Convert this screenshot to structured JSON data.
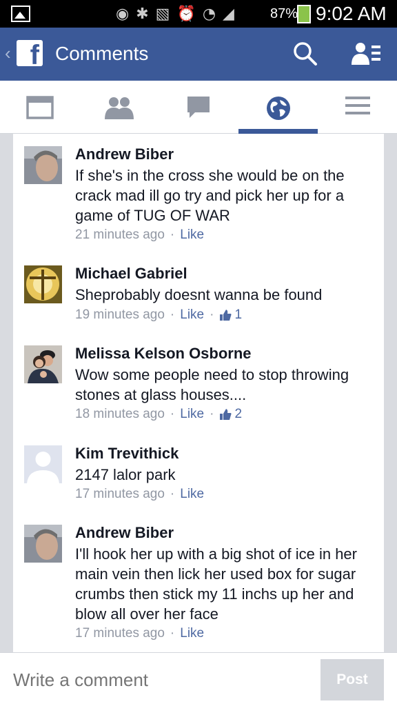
{
  "status_bar": {
    "battery": "87%",
    "time": "9:02 AM"
  },
  "header": {
    "back_glyph": "‹",
    "logo_letter": "f",
    "title": "Comments"
  },
  "tabs": [
    {
      "icon": "news-feed-icon",
      "active": false
    },
    {
      "icon": "friends-icon",
      "active": false
    },
    {
      "icon": "messages-icon",
      "active": false
    },
    {
      "icon": "globe-icon",
      "active": true
    },
    {
      "icon": "menu-icon",
      "active": false
    }
  ],
  "comments": [
    {
      "author": "Andrew Biber",
      "text": "If she's in the cross she would be on the crack mad ill go try and pick her up for a game of TUG OF WAR",
      "time": "21 minutes ago",
      "like_label": "Like",
      "likes": ""
    },
    {
      "author": "Michael Gabriel",
      "text": "Sheprobably doesnt wanna be found",
      "time": "19 minutes ago",
      "like_label": "Like",
      "likes": "1"
    },
    {
      "author": "Melissa Kelson Osborne",
      "text": "Wow some people need to stop throwing stones at glass houses....",
      "time": "18 minutes ago",
      "like_label": "Like",
      "likes": "2"
    },
    {
      "author": "Kim Trevithick",
      "text": "2147 lalor park",
      "time": "17 minutes ago",
      "like_label": "Like",
      "likes": ""
    },
    {
      "author": "Andrew Biber",
      "text": "I'll hook her up with a big shot of ice in her main vein then lick her used box for sugar crumbs then stick my 11 inchs up her and blow all over her face",
      "time": "17 minutes ago",
      "like_label": "Like",
      "likes": ""
    }
  ],
  "composer": {
    "placeholder": "Write a comment",
    "post_label": "Post"
  },
  "colors": {
    "brand": "#3b5998",
    "link": "#4e69a2",
    "muted": "#9197a3"
  }
}
